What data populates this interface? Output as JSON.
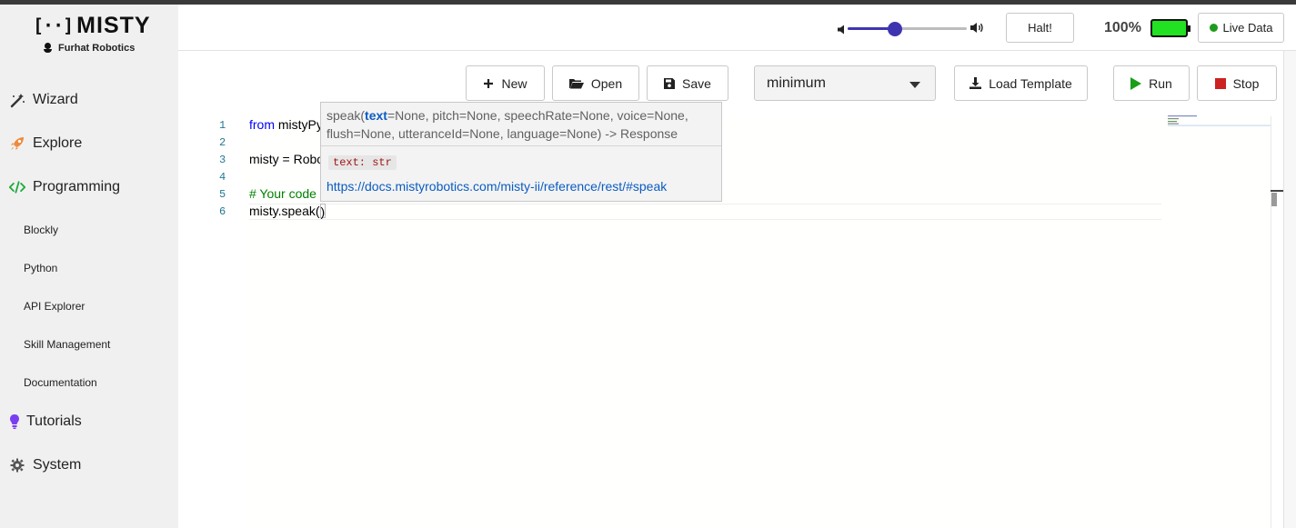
{
  "sidebar": {
    "logo_brackets": "[··]",
    "logo_text": "MISTY",
    "sublogo": "Furhat Robotics",
    "main_items": [
      {
        "label": "Wizard"
      },
      {
        "label": "Explore"
      },
      {
        "label": "Programming"
      },
      {
        "label": "Tutorials"
      },
      {
        "label": "System"
      }
    ],
    "sub_items": [
      {
        "label": "Blockly"
      },
      {
        "label": "Python"
      },
      {
        "label": "API Explorer"
      },
      {
        "label": "Skill Management"
      },
      {
        "label": "Documentation"
      }
    ]
  },
  "topbar": {
    "volume_level": 0.4,
    "halt_label": "Halt!",
    "battery_percent": "100%",
    "live_data_label": "Live Data",
    "accent_color": "#3f34b0",
    "battery_color": "#22e022"
  },
  "toolbar": {
    "new_label": "New",
    "open_label": "Open",
    "save_label": "Save",
    "template_selected": "minimum",
    "load_template_label": "Load Template",
    "run_label": "Run",
    "stop_label": "Stop"
  },
  "editor": {
    "line_numbers": [
      "1",
      "2",
      "3",
      "4",
      "5",
      "6"
    ],
    "lines": {
      "l1_kw": "from",
      "l1_rest": " mistyPy",
      "l3": "misty = Robo",
      "l5": "# Your code",
      "l6_pre": "misty.speak(",
      "l6_post": ")"
    }
  },
  "hover": {
    "sig_prefix": "speak(",
    "sig_param": "text",
    "sig_rest": "=None, pitch=None, speechRate=None, voice=None, flush=None, utteranceId=None, language=None) -> Response",
    "param_tag": "text: str",
    "doc_link": "https://docs.mistyrobotics.com/misty-ii/reference/rest/#speak"
  }
}
